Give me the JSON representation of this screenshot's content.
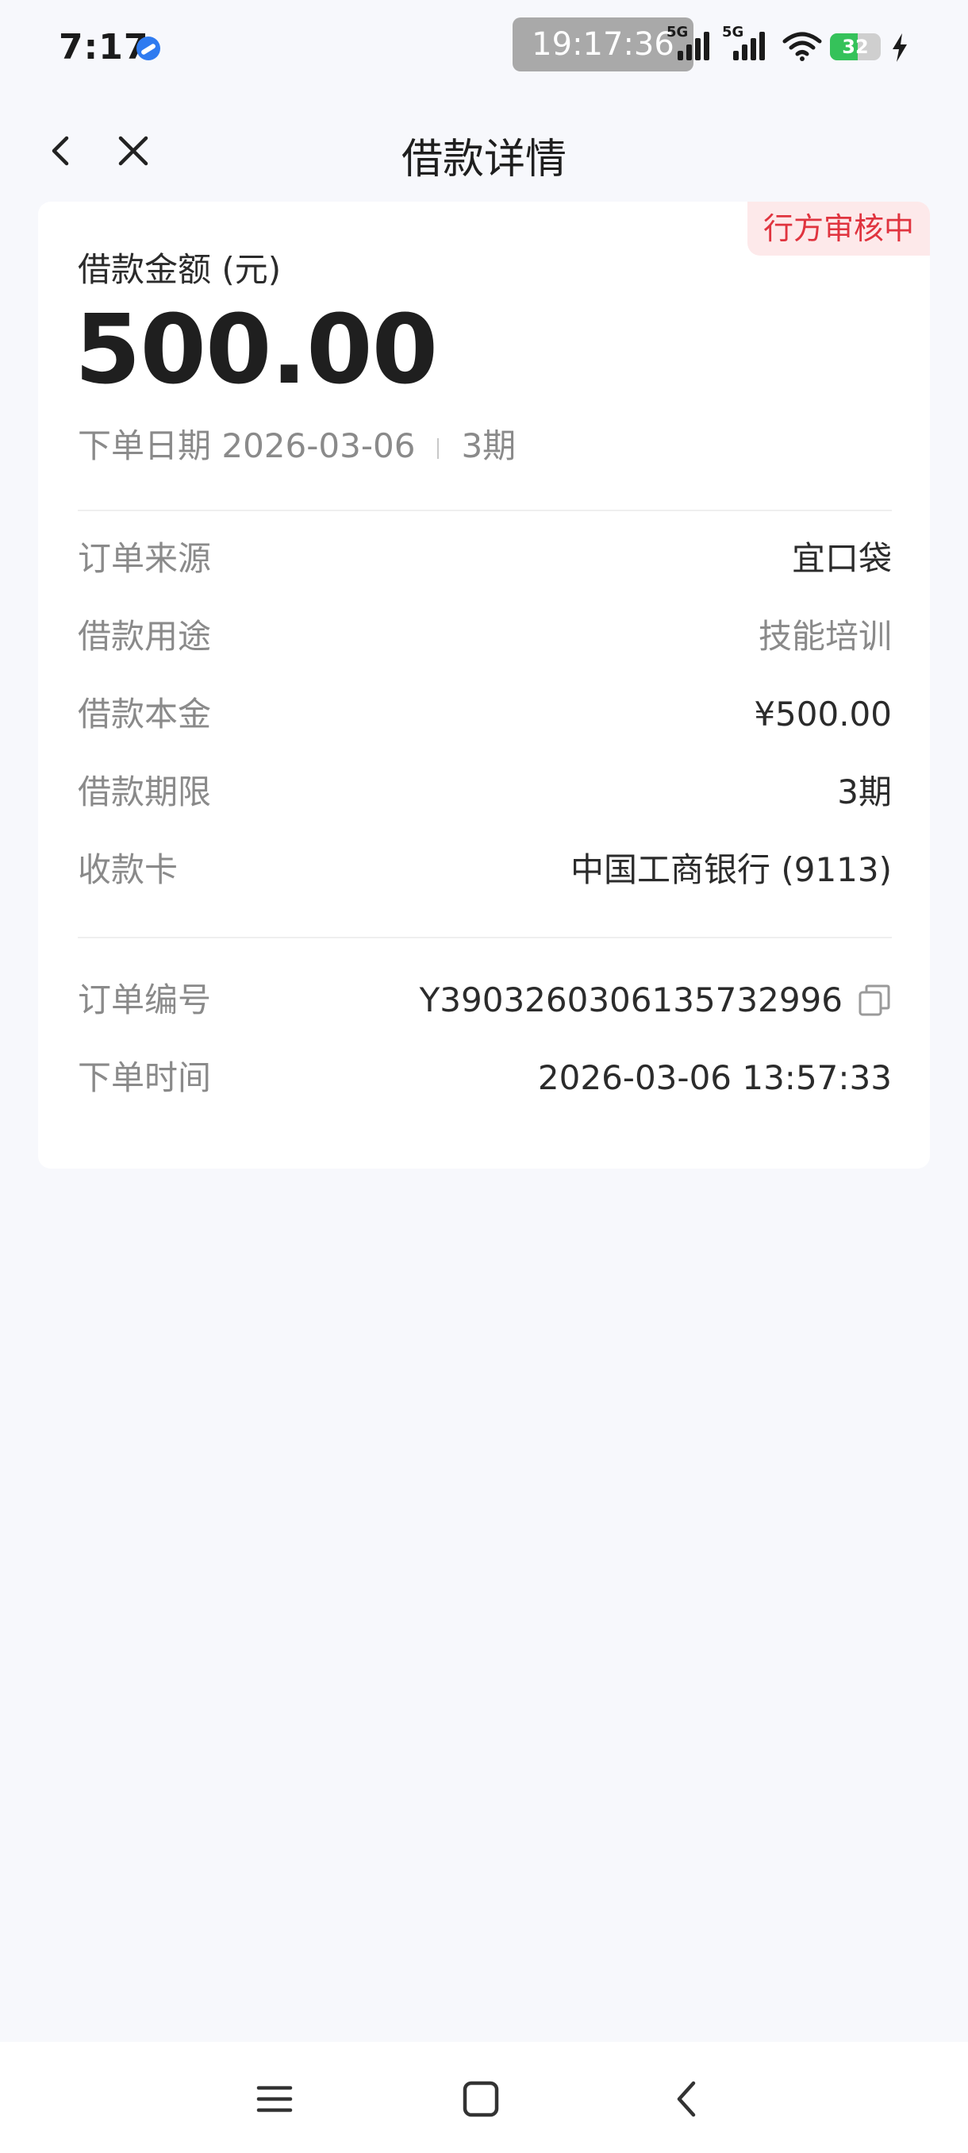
{
  "status_bar": {
    "time": "7:17",
    "clock_overlay": "19:17:36",
    "signal_1_label": "5G",
    "signal_2_label": "5G",
    "battery_level": "32",
    "battery_fraction": 0.32,
    "app_icon": "app-dot-icon"
  },
  "nav": {
    "title": "借款详情",
    "back_icon": "chevron-left-icon",
    "close_icon": "close-icon"
  },
  "card": {
    "status_badge": "行方审核中",
    "amount_label": "借款金额 (元)",
    "amount_value": "500.00",
    "order_date_text": "下单日期 2026-03-06",
    "term_text": "3期",
    "details": [
      {
        "label": "订单来源",
        "value": "宜口袋"
      },
      {
        "label": "借款用途",
        "value": "技能培训"
      },
      {
        "label": "借款本金",
        "value": "¥500.00"
      },
      {
        "label": "借款期限",
        "value": "3期"
      },
      {
        "label": "收款卡",
        "value": "中国工商银行 (9113)"
      }
    ],
    "order_info": [
      {
        "label": "订单编号",
        "value": "Y3903260306135732996"
      },
      {
        "label": "下单时间",
        "value": "2026-03-06 13:57:33"
      }
    ]
  },
  "system_nav": {
    "menu_icon": "menu-icon",
    "home_icon": "home-icon",
    "back_icon": "back-icon"
  },
  "colors": {
    "badge_text": "#e0343f",
    "badge_bg": "#fde9ea",
    "page_bg": "#f7f8fc",
    "battery_green": "#35c25a"
  }
}
